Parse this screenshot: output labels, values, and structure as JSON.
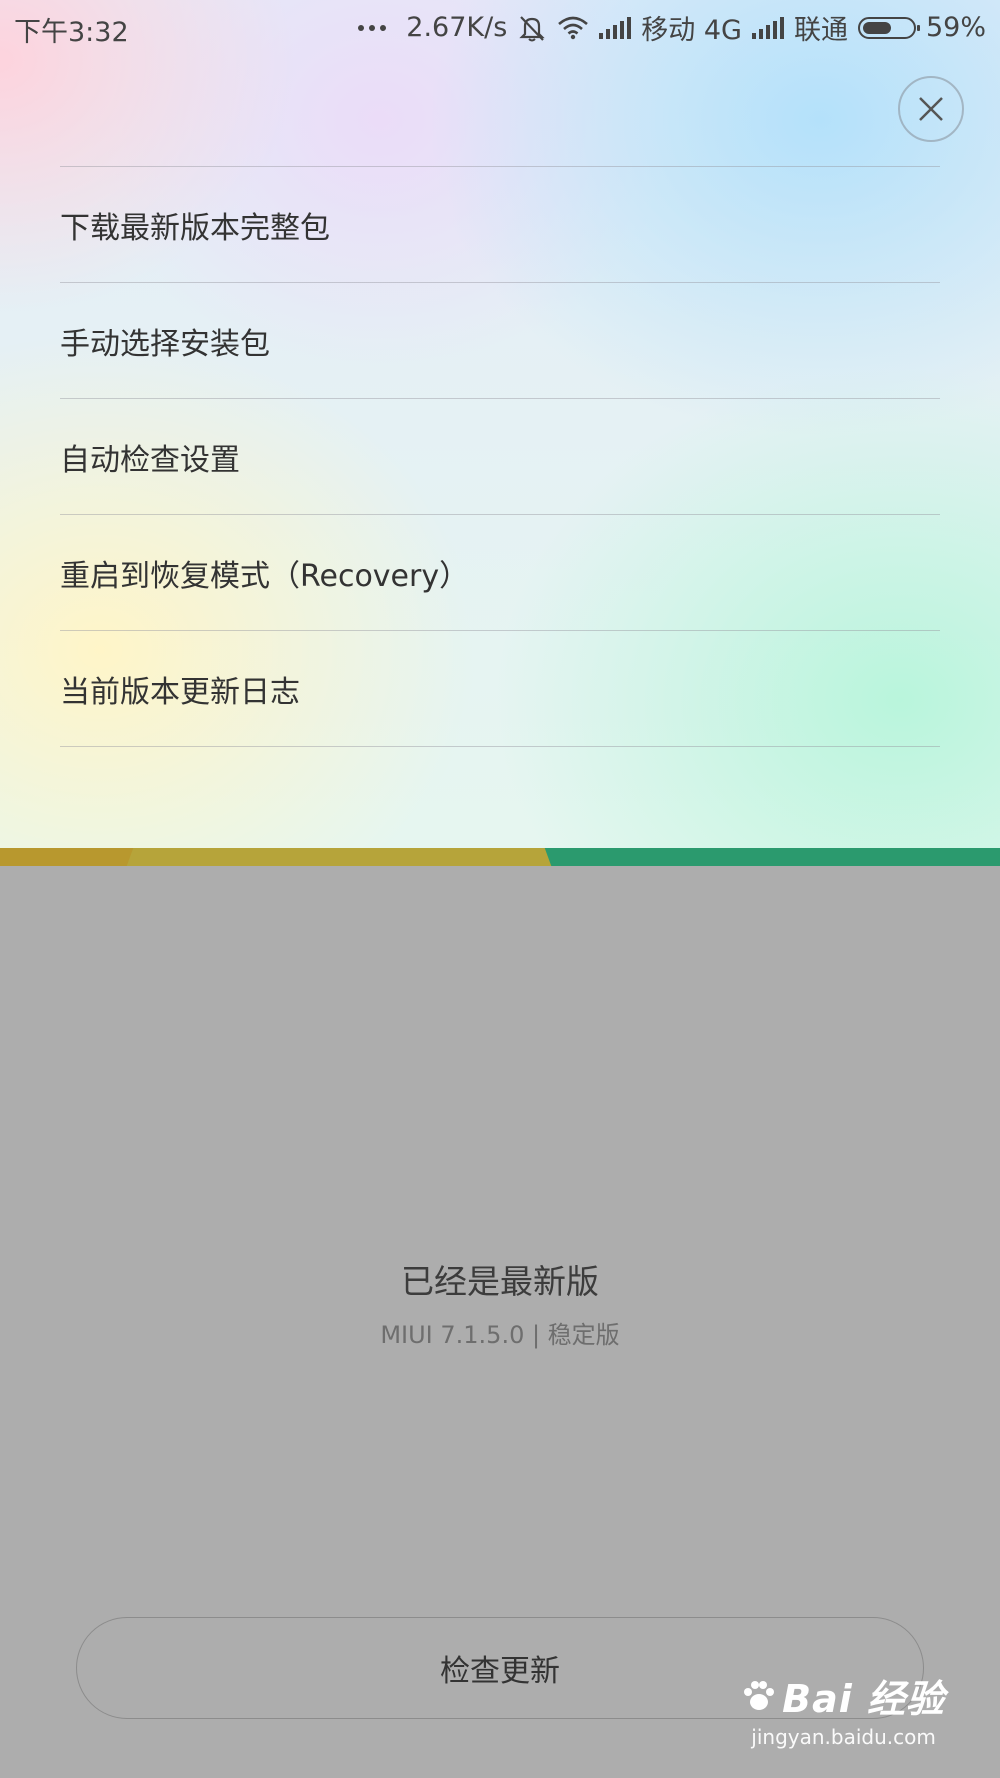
{
  "status_bar": {
    "time": "下午3:32",
    "speed": "2.67K/s",
    "carrier1": "移动 4G",
    "carrier2": "联通",
    "battery": "59%",
    "battery_level": 0.59
  },
  "menu": {
    "items": [
      {
        "label": "下载最新版本完整包"
      },
      {
        "label": "手动选择安装包"
      },
      {
        "label": "自动检查设置"
      },
      {
        "label": "重启到恢复模式（Recovery）"
      },
      {
        "label": "当前版本更新日志"
      }
    ]
  },
  "status": {
    "title": "已经是最新版",
    "version": "MIUI 7.1.5.0 | 稳定版"
  },
  "check_button": {
    "label": "检查更新"
  },
  "watermark": {
    "logo": "Bai 经验",
    "url": "jingyan.baidu.com"
  },
  "colors": {
    "accent_gold": "#b6a43a",
    "accent_green": "#2b9a6e",
    "background_gray": "#adadad"
  },
  "icons": [
    "more-dots-icon",
    "bell-off-icon",
    "wifi-icon",
    "signal-icon",
    "battery-icon",
    "close-icon",
    "paw-icon"
  ]
}
